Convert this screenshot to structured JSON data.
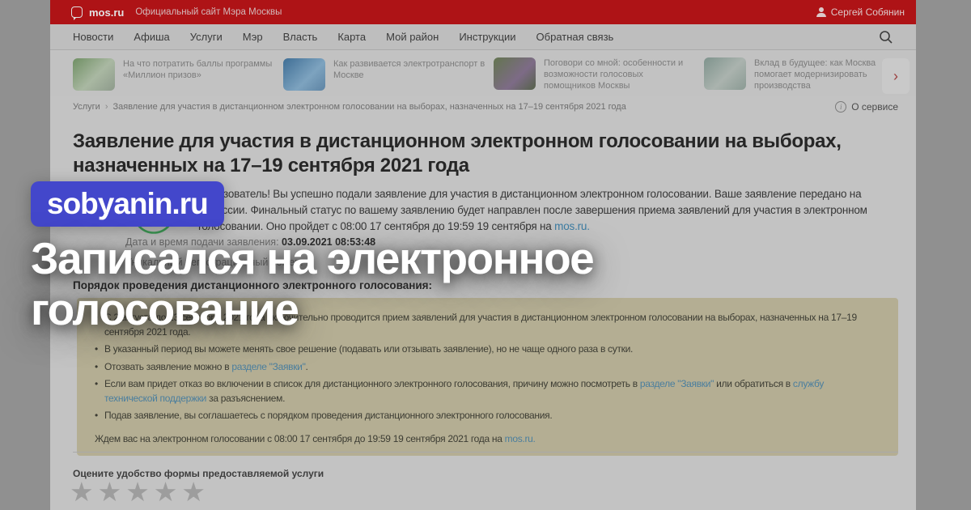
{
  "header": {
    "logo_text": "mos.ru",
    "logo_subtitle": "Официальный сайт Мэра Москвы",
    "user_name": "Сергей Собянин"
  },
  "nav": {
    "items": [
      "Новости",
      "Афиша",
      "Услуги",
      "Мэр",
      "Власть",
      "Карта",
      "Мой район",
      "Инструкции",
      "Обратная связь"
    ]
  },
  "news_carousel": {
    "items": [
      {
        "title": "На что потратить баллы программы «Миллион призов»"
      },
      {
        "title": "Как развивается электротранспорт в Москве"
      },
      {
        "title": "Поговори со мной: особенности и возможности голосовых помощников Москвы"
      },
      {
        "title": "Вклад в будущее: как Москва помогает модернизировать производства"
      }
    ],
    "next_glyph": "›"
  },
  "breadcrumb": {
    "root": "Услуги",
    "separator": "›",
    "current": "Заявление для участия в дистанционном электронном голосовании на выборах, назначенных на 17–19 сентября 2021 года",
    "about_service": "О сервисе",
    "info_glyph": "i"
  },
  "page": {
    "title": "Заявление для участия в дистанционном электронном голосовании на выборах, назначенных на 17–19 сентября 2021 года"
  },
  "application": {
    "status_line1": "Пользователь! Вы успешно подали заявление для участия в дистанционном электронном голосовании. Ваше заявление передано на",
    "status_line2": "комиссии. Финальный статус по вашему заявлению будет направлен после завершения приема заявлений для участия в электронном",
    "status_line3_prefix": "голосовании. Оно пройдет с 08:00 17 сентября до 19:59 19 сентября на ",
    "status_line3_link": "mos.ru.",
    "date_label": "Дата и время подачи заявления:",
    "date_value": "03.09.2021 08:53:48",
    "reg_number_label": "Уникальный регистрационный номер:"
  },
  "procedure": {
    "heading": "Порядок проведения дистанционного электронного голосования:",
    "bullet1": "С 2 августа до 13 сентября 2021 года включительно проводится прием заявлений для участия в дистанционном электронном голосовании на выборах, назначенных на 17–19 сентября 2021 года.",
    "bullet2": "В указанный период вы можете менять свое решение (подавать или отзывать заявление), но не чаще одного раза в сутки.",
    "bullet3_prefix": "Отозвать заявление можно в ",
    "bullet3_link": "разделе \"Заявки\"",
    "bullet3_suffix": ".",
    "bullet4_part1": "Если вам придет отказ во включении в список для дистанционного электронного голосования, причину можно посмотреть в ",
    "bullet4_link1": "разделе \"Заявки\"",
    "bullet4_part2": " или обратиться в ",
    "bullet4_link2": "службу технической поддержки",
    "bullet4_part3": " за разъяснением.",
    "bullet5": "Подав заявление, вы соглашаетесь с порядком проведения дистанционного электронного голосования.",
    "footer_prefix": "Ждем вас на электронном голосовании с 08:00 17 сентября до 19:59 19 сентября 2021 года на ",
    "footer_link": "mos.ru."
  },
  "rating": {
    "label": "Оцените удобство формы предоставляемой услуги",
    "star_glyph": "★",
    "stars_total": 5,
    "stars_selected": 0
  },
  "overlay": {
    "badge": "sobyanin.ru",
    "title_line1": "Записался на электронное",
    "title_line2": "голосование",
    "badge_color": "#4347cb"
  },
  "colors": {
    "header_red": "#ae1316",
    "notice_beige": "#b4ae93",
    "link_blue": "#3d7da3",
    "success_green": "#3f9e57"
  }
}
